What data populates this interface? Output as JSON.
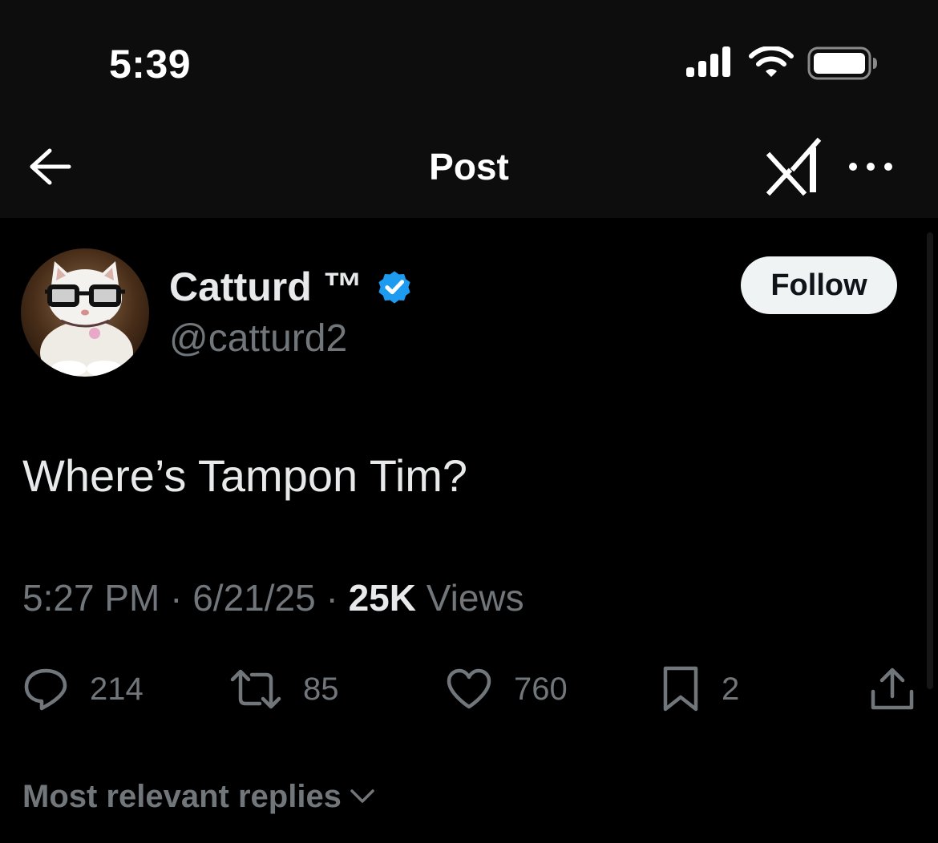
{
  "status_bar": {
    "time": "5:39",
    "signal_icon": "cellular-signal-icon",
    "wifi_icon": "wifi-icon",
    "battery_icon": "battery-icon"
  },
  "nav": {
    "title": "Post",
    "back_icon": "back-arrow-icon",
    "grok_icon": "grok-xai-icon",
    "more_icon": "more-horizontal-icon"
  },
  "author": {
    "display_name": "Catturd ™",
    "handle": "@catturd2",
    "verified": true,
    "verified_color": "#1d9bf0",
    "avatar_icon": "cat-with-glasses-avatar"
  },
  "follow_button": {
    "label": "Follow"
  },
  "post": {
    "text": "Where’s Tampon Tim?",
    "time": "5:27 PM",
    "separator": "·",
    "date": "6/21/25",
    "views_count": "25K",
    "views_label": "Views"
  },
  "actions": {
    "replies": {
      "icon": "reply-icon",
      "count": "214"
    },
    "reposts": {
      "icon": "repost-icon",
      "count": "85"
    },
    "likes": {
      "icon": "heart-icon",
      "count": "760"
    },
    "bookmarks": {
      "icon": "bookmark-icon",
      "count": "2"
    },
    "share": {
      "icon": "share-icon"
    }
  },
  "replies_filter": {
    "label": "Most relevant replies",
    "icon": "chevron-down-icon"
  },
  "colors": {
    "background": "#000000",
    "header_background": "#0d0d0d",
    "primary_text": "#e7e9ea",
    "secondary_text": "#71767b",
    "accent": "#1d9bf0",
    "follow_bg": "#eff3f4"
  }
}
